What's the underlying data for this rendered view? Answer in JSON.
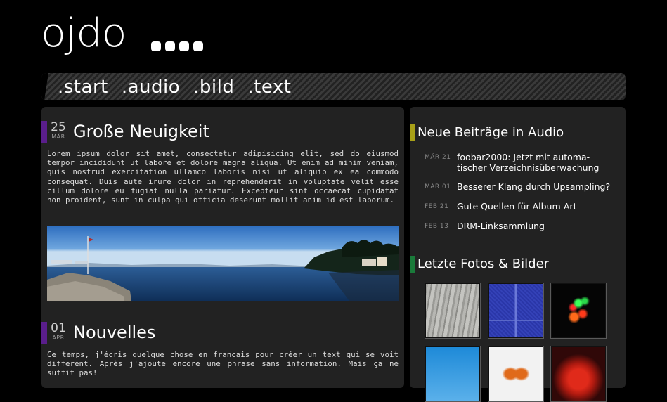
{
  "brand": {
    "name": "ojdo"
  },
  "nav": {
    "items": [
      ".start",
      ".audio",
      ".bild",
      ".text"
    ]
  },
  "posts": [
    {
      "day": "25",
      "month": "MÄR",
      "title": "Große Neuigkeit",
      "body": "Lorem ipsum dolor sit amet, consectetur adipisicing elit, sed do eiusmod tempor incididunt ut labore et dolore magna aliqua. Ut enim ad minim veniam, quis nostrud exercitation ullamco laboris nisi ut aliquip ex ea commodo consequat. Duis aute irure dolor in reprehenderit in voluptate velit esse cillum dolore eu fugiat nulla pariatur. Excepteur sint occaecat cupidatat non proident, sunt in culpa qui officia deserunt mollit anim id est laborum."
    },
    {
      "day": "01",
      "month": "APR",
      "title": "Nouvelles",
      "body": "Ce temps, j'écris quelque chose en francais pour créer un text qui se voit different. Après j'ajoute encore une phrase sans information. Mais ça ne suffit pas!"
    }
  ],
  "sidebar": {
    "audio": {
      "heading": "Neue Beiträge in Audio",
      "marker_color": "#a8a018",
      "items": [
        {
          "date": "MÄR 21",
          "title": "foobar2000: Jetzt mit automa-tischer Verzeichnisüberwachung"
        },
        {
          "date": "MÄR 01",
          "title": "Besserer Klang durch Upsampling?"
        },
        {
          "date": "FEB 21",
          "title": "Gute Quellen für Album-Art"
        },
        {
          "date": "FEB 13",
          "title": "DRM-Linksammlung"
        }
      ]
    },
    "photos": {
      "heading": "Letzte Fotos & Bilder",
      "marker_color": "#1a7a3a"
    }
  },
  "colors": {
    "post_marker": "#5a1e8c",
    "panel": "#222222",
    "background": "#000000"
  }
}
